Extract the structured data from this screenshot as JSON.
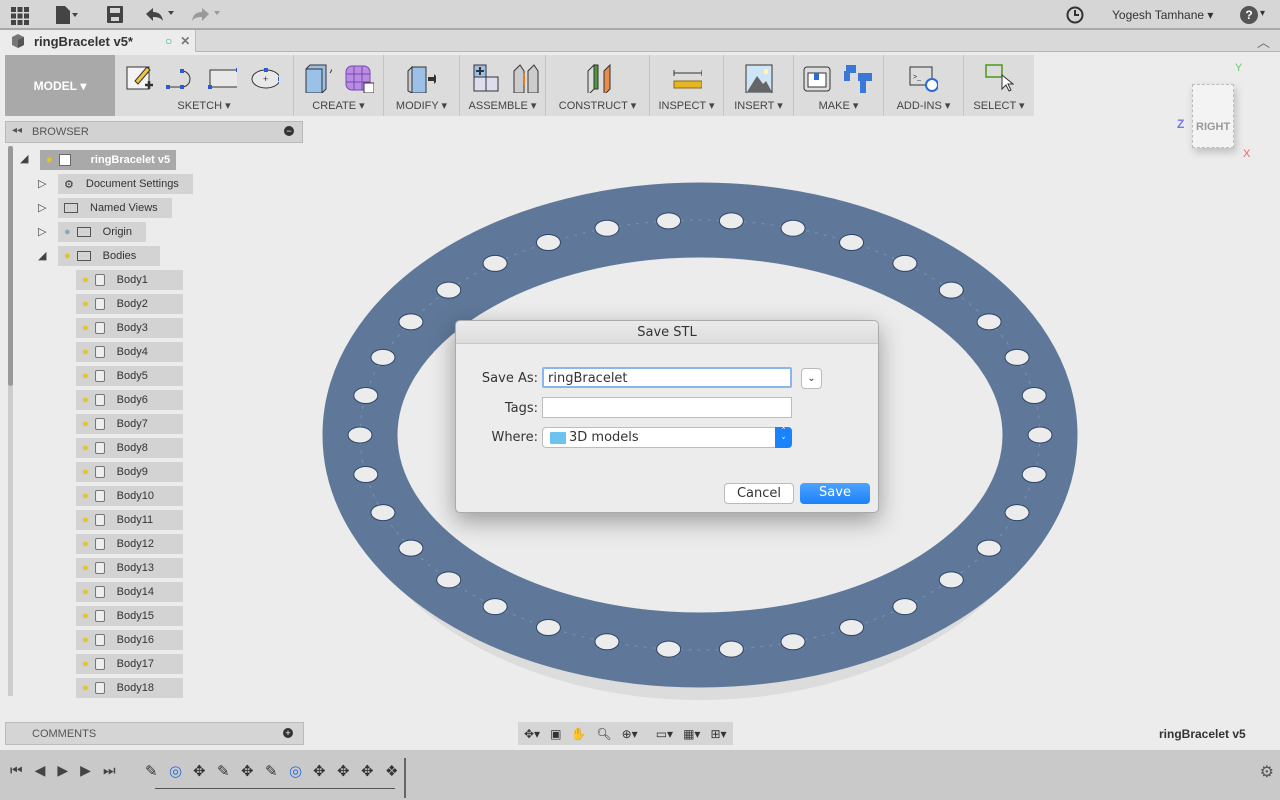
{
  "app": {
    "user": "Yogesh Tamhane",
    "document_tab": "ringBracelet v5*",
    "doc_name_footer": "ringBracelet v5"
  },
  "toolbar": {
    "workspace": "MODEL",
    "groups": [
      "SKETCH",
      "CREATE",
      "MODIFY",
      "ASSEMBLE",
      "CONSTRUCT",
      "INSPECT",
      "INSERT",
      "MAKE",
      "ADD-INS",
      "SELECT"
    ]
  },
  "viewcube": {
    "face": "RIGHT",
    "axes": {
      "y": "Y",
      "z": "Z",
      "x": "X"
    }
  },
  "browser": {
    "title": "BROWSER",
    "root": "ringBracelet v5",
    "folders": [
      "Document Settings",
      "Named Views",
      "Origin",
      "Bodies"
    ],
    "bodies": [
      "Body1",
      "Body2",
      "Body3",
      "Body4",
      "Body5",
      "Body6",
      "Body7",
      "Body8",
      "Body9",
      "Body10",
      "Body11",
      "Body12",
      "Body13",
      "Body14",
      "Body15",
      "Body16",
      "Body17",
      "Body18"
    ]
  },
  "comments": {
    "title": "COMMENTS"
  },
  "dialog": {
    "title": "Save STL",
    "save_as_label": "Save As:",
    "save_as_value": "ringBracelet",
    "tags_label": "Tags:",
    "tags_value": "",
    "where_label": "Where:",
    "where_value": "3D models",
    "cancel": "Cancel",
    "save": "Save"
  },
  "colors": {
    "model": "#5f7899",
    "accent": "#1a82fb",
    "toolbar": "#dcdcdc"
  }
}
